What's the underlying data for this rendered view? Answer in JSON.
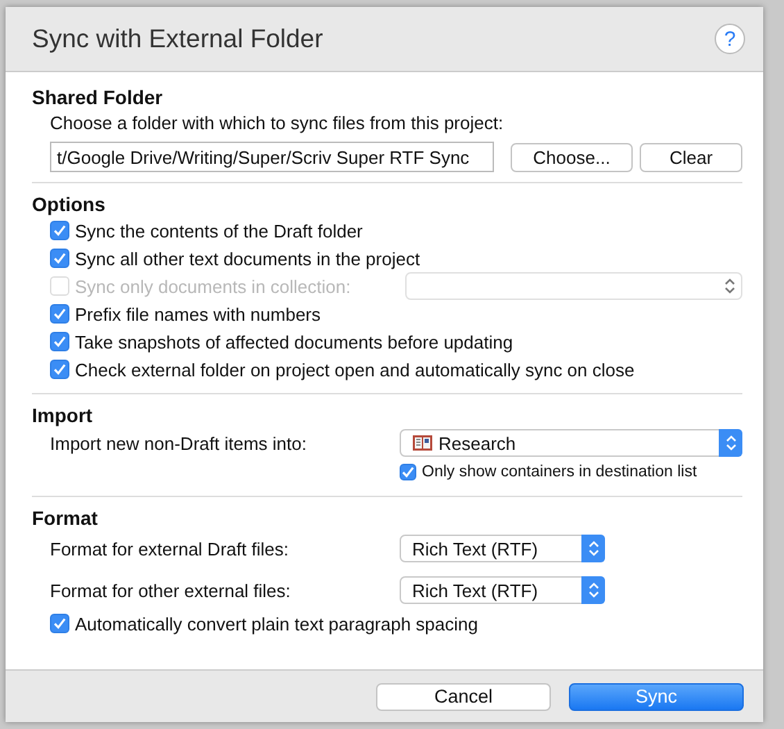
{
  "dialog": {
    "title": "Sync with External Folder",
    "help_button": "?"
  },
  "shared_folder": {
    "heading": "Shared Folder",
    "instruction": "Choose a folder with which to sync files from this project:",
    "path": "t/Google Drive/Writing/Super/Scriv Super RTF Sync",
    "buttons": [
      "Choose...",
      "Clear"
    ]
  },
  "options": {
    "heading": "Options",
    "items": [
      {
        "kind": "checkbox",
        "label": "Sync the contents of the Draft folder",
        "checked": true,
        "disabled": false
      },
      {
        "kind": "checkbox",
        "label": "Sync all other text documents in the project",
        "checked": true,
        "disabled": false
      },
      {
        "kind": "checkbox_popup",
        "label": "Sync only documents in collection:",
        "checked": false,
        "disabled": true
      },
      {
        "kind": "checkbox",
        "label": "Prefix file names with numbers",
        "checked": true,
        "disabled": false
      },
      {
        "kind": "checkbox",
        "label": "Take snapshots of affected documents before updating",
        "checked": true,
        "disabled": false
      },
      {
        "kind": "checkbox",
        "label": "Check external folder on project open and automatically sync on close",
        "checked": true,
        "disabled": false
      }
    ]
  },
  "import": {
    "heading": "Import",
    "label": "Import new non-Draft items into:",
    "destination": "Research",
    "containers_only": {
      "label": "Only show containers in destination list",
      "checked": true
    }
  },
  "format": {
    "heading": "Format",
    "rows": [
      {
        "label": "Format for external Draft files:",
        "value": "Rich Text (RTF)"
      },
      {
        "label": "Format for other external files:",
        "value": "Rich Text (RTF)"
      }
    ],
    "convert_spacing": {
      "label": "Automatically convert plain text paragraph spacing",
      "checked": true
    }
  },
  "buttons": [
    {
      "label": "Cancel",
      "default": false
    },
    {
      "label": "Sync",
      "default": true
    }
  ]
}
